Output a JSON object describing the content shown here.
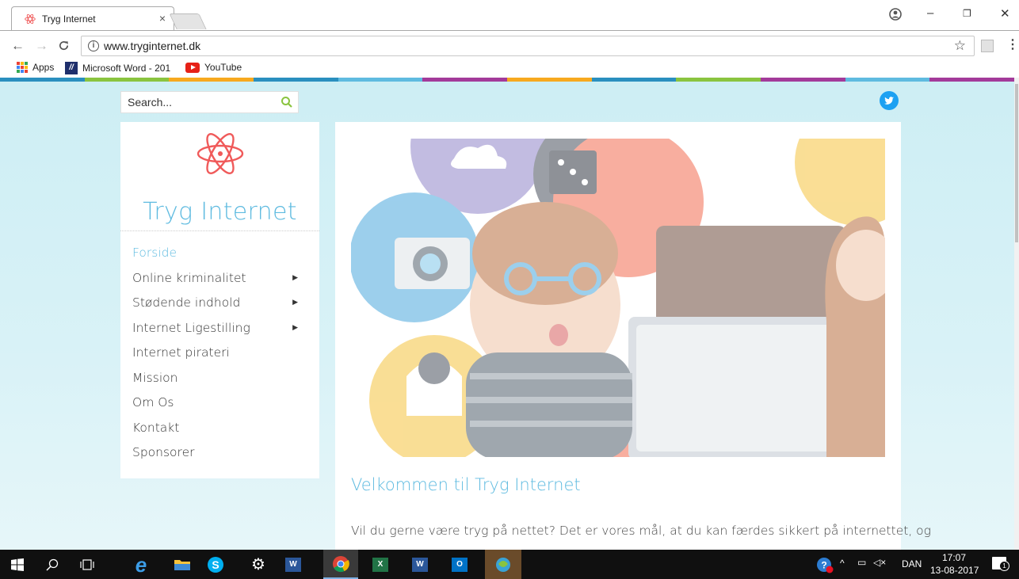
{
  "browser": {
    "tab_title": "Tryg Internet",
    "tab_close": "×",
    "url": "www.tryginternet.dk",
    "info": "i",
    "window_controls": [
      "–",
      "❐",
      "✕"
    ]
  },
  "bookmarks": [
    {
      "label": "Apps",
      "icon": "apps-grid-icon"
    },
    {
      "label": "Microsoft Word - 201",
      "icon": "word-icon"
    },
    {
      "label": "YouTube",
      "icon": "youtube-icon"
    }
  ],
  "colors": {
    "accent": "#5fbbe0",
    "stripe": [
      "#2a8fbf",
      "#8ac43f",
      "#f7a91f",
      "#2a8fbf",
      "#5fbbe0",
      "#a33a9a",
      "#f7a91f",
      "#2a8fbf",
      "#8ac43f",
      "#a33a9a",
      "#5fbbe0",
      "#a33a9a"
    ]
  },
  "search": {
    "placeholder": "Search..."
  },
  "site": {
    "name": "Tryg Internet",
    "menu": [
      {
        "label": "Forside",
        "active": true,
        "submenu": false
      },
      {
        "label": "Online kriminalitet",
        "active": false,
        "submenu": true
      },
      {
        "label": "Stødende indhold",
        "active": false,
        "submenu": true
      },
      {
        "label": "Internet Ligestilling",
        "active": false,
        "submenu": true
      },
      {
        "label": "Internet pirateri",
        "active": false,
        "submenu": false
      },
      {
        "label": "Mission",
        "active": false,
        "submenu": false
      },
      {
        "label": "Om Os",
        "active": false,
        "submenu": false
      },
      {
        "label": "Kontakt",
        "active": false,
        "submenu": false
      },
      {
        "label": "Sponsorer",
        "active": false,
        "submenu": false
      }
    ]
  },
  "content": {
    "title": "Velkommen til Tryg Internet",
    "intro": "Vil du gerne være tryg på nettet? Det er vores mål, at du kan færdes sikkert på internettet, og"
  },
  "taskbar": {
    "language": "DAN",
    "time": "17:07",
    "date": "13-08-2017",
    "notifications": "1"
  }
}
